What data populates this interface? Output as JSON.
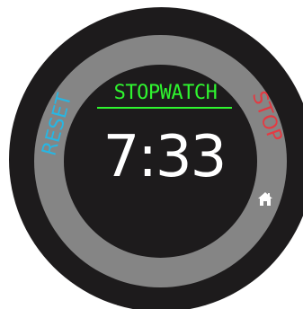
{
  "app": {
    "title": "STOPWATCH"
  },
  "stopwatch": {
    "time": "7:33"
  },
  "controls": {
    "reset_label": "RESET",
    "stop_label": "STOP",
    "home_icon": "home-icon"
  },
  "colors": {
    "background": "#1d1b1c",
    "ring": "#858585",
    "title": "#2ff52f",
    "time": "#ffffff",
    "reset": "#27b6e3",
    "stop": "#e43a42"
  }
}
